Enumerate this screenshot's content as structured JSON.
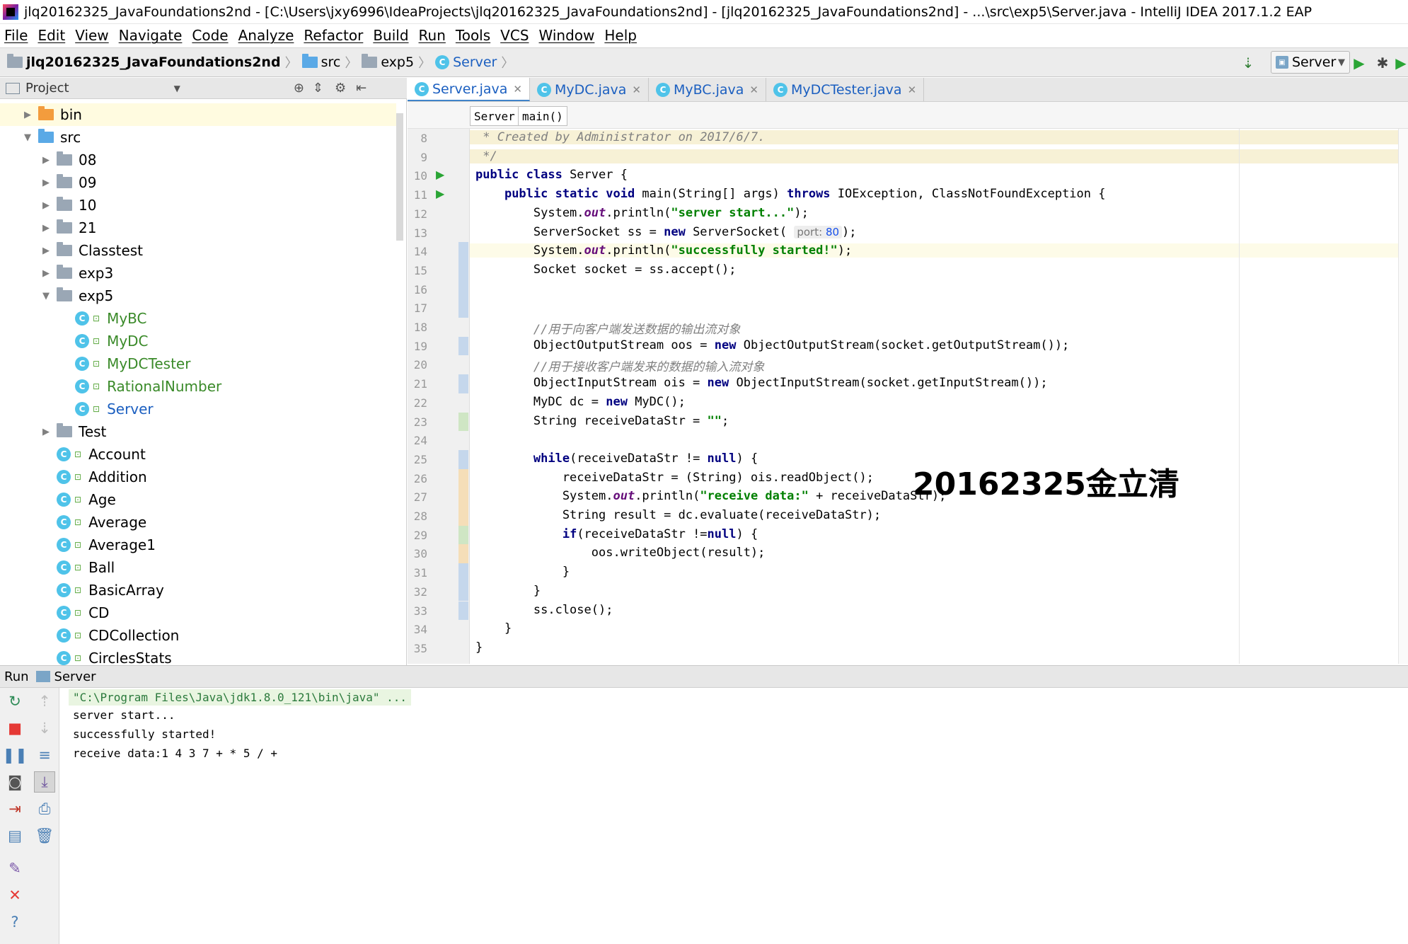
{
  "window": {
    "title": "jlq20162325_JavaFoundations2nd - [C:\\Users\\jxy6996\\IdeaProjects\\jlq20162325_JavaFoundations2nd] - [jlq20162325_JavaFoundations2nd] - ...\\src\\exp5\\Server.java - IntelliJ IDEA 2017.1.2 EAP"
  },
  "menu": [
    "File",
    "Edit",
    "View",
    "Navigate",
    "Code",
    "Analyze",
    "Refactor",
    "Build",
    "Run",
    "Tools",
    "VCS",
    "Window",
    "Help"
  ],
  "navbar": {
    "crumbs": [
      "jlq20162325_JavaFoundations2nd",
      "src",
      "exp5",
      "Server"
    ],
    "run_config": "Server"
  },
  "project": {
    "header": "Project",
    "tree": [
      {
        "label": "bin",
        "type": "folder-orange",
        "indent": 0,
        "arrow": "▶"
      },
      {
        "label": "src",
        "type": "folder-blue",
        "indent": 0,
        "arrow": "▼"
      },
      {
        "label": "08",
        "type": "package",
        "indent": 1,
        "arrow": "▶"
      },
      {
        "label": "09",
        "type": "package",
        "indent": 1,
        "arrow": "▶"
      },
      {
        "label": "10",
        "type": "package",
        "indent": 1,
        "arrow": "▶"
      },
      {
        "label": "21",
        "type": "package",
        "indent": 1,
        "arrow": "▶"
      },
      {
        "label": "Classtest",
        "type": "package",
        "indent": 1,
        "arrow": "▶"
      },
      {
        "label": "exp3",
        "type": "package",
        "indent": 1,
        "arrow": "▶"
      },
      {
        "label": "exp5",
        "type": "package",
        "indent": 1,
        "arrow": "▼"
      },
      {
        "label": "MyBC",
        "type": "class-green",
        "indent": 2,
        "arrow": ""
      },
      {
        "label": "MyDC",
        "type": "class-green",
        "indent": 2,
        "arrow": ""
      },
      {
        "label": "MyDCTester",
        "type": "class-green",
        "indent": 2,
        "arrow": ""
      },
      {
        "label": "RationalNumber",
        "type": "class-green",
        "indent": 2,
        "arrow": ""
      },
      {
        "label": "Server",
        "type": "class-blue",
        "indent": 2,
        "arrow": ""
      },
      {
        "label": "Test",
        "type": "package",
        "indent": 1,
        "arrow": "▶"
      },
      {
        "label": "Account",
        "type": "class",
        "indent": 1,
        "arrow": ""
      },
      {
        "label": "Addition",
        "type": "class",
        "indent": 1,
        "arrow": ""
      },
      {
        "label": "Age",
        "type": "class",
        "indent": 1,
        "arrow": ""
      },
      {
        "label": "Average",
        "type": "class",
        "indent": 1,
        "arrow": ""
      },
      {
        "label": "Average1",
        "type": "class",
        "indent": 1,
        "arrow": ""
      },
      {
        "label": "Ball",
        "type": "class",
        "indent": 1,
        "arrow": ""
      },
      {
        "label": "BasicArray",
        "type": "class",
        "indent": 1,
        "arrow": ""
      },
      {
        "label": "CD",
        "type": "class",
        "indent": 1,
        "arrow": ""
      },
      {
        "label": "CDCollection",
        "type": "class",
        "indent": 1,
        "arrow": ""
      },
      {
        "label": "CirclesStats",
        "type": "class",
        "indent": 1,
        "arrow": ""
      }
    ]
  },
  "editor": {
    "tabs": [
      "Server.java",
      "MyDC.java",
      "MyBC.java",
      "MyDCTester.java"
    ],
    "crumbs": [
      "Server",
      "main()"
    ],
    "lines": [
      {
        "n": "8",
        "html": "<span class='cm'> * Created by Administrator on 2017/6/7.</span>"
      },
      {
        "n": "9",
        "html": "<span class='cm'> */</span>"
      },
      {
        "n": "10",
        "html": "<span class='kw'>public class</span> Server {"
      },
      {
        "n": "11",
        "html": "    <span class='kw'>public static void</span> main(String[] args) <span class='kw'>throws</span> IOException, ClassNotFoundException {"
      },
      {
        "n": "12",
        "html": "        System.<span class='fld'>out</span>.println(<span class='str'>\"server start...\"</span>);"
      },
      {
        "n": "13",
        "html": "        ServerSocket ss = <span class='kw'>new</span> ServerSocket( <span class='hint'>port: <span class='hintnum'>80</span></span>);"
      },
      {
        "n": "14",
        "html": "        System.<span class='fld'>out</span>.println(<span class='str'>\"successfully started!\"</span>);"
      },
      {
        "n": "15",
        "html": "        Socket socket = ss.accept();"
      },
      {
        "n": "16",
        "html": ""
      },
      {
        "n": "17",
        "html": ""
      },
      {
        "n": "18",
        "html": "        <span class='cm'>//用于向客户端发送数据的输出流对象</span>"
      },
      {
        "n": "19",
        "html": "        ObjectOutputStream oos = <span class='kw'>new</span> ObjectOutputStream(socket.getOutputStream());"
      },
      {
        "n": "20",
        "html": "        <span class='cm'>//用于接收客户端发来的数据的输入流对象</span>"
      },
      {
        "n": "21",
        "html": "        ObjectInputStream ois = <span class='kw'>new</span> ObjectInputStream(socket.getInputStream());"
      },
      {
        "n": "22",
        "html": "        MyDC dc = <span class='kw'>new</span> MyDC();"
      },
      {
        "n": "23",
        "html": "        String receiveDataStr = <span class='str'>\"\"</span>;"
      },
      {
        "n": "24",
        "html": ""
      },
      {
        "n": "25",
        "html": "        <span class='kw'>while</span>(receiveDataStr != <span class='kw'>null</span>) {"
      },
      {
        "n": "26",
        "html": "            receiveDataStr = (String) ois.readObject();"
      },
      {
        "n": "27",
        "html": "            System.<span class='fld'>out</span>.println(<span class='str'>\"receive data:\"</span> + receiveDataStr);"
      },
      {
        "n": "28",
        "html": "            String result = dc.evaluate(receiveDataStr);"
      },
      {
        "n": "29",
        "html": "            <span class='kw'>if</span>(receiveDataStr !=<span class='kw'>null</span>) {"
      },
      {
        "n": "30",
        "html": "                oos.writeObject(result);"
      },
      {
        "n": "31",
        "html": "            }"
      },
      {
        "n": "32",
        "html": "        }"
      },
      {
        "n": "33",
        "html": "        ss.close();"
      },
      {
        "n": "34",
        "html": "    }"
      },
      {
        "n": "35",
        "html": "}"
      }
    ],
    "watermark": "20162325金立清"
  },
  "run": {
    "label": "Run",
    "config": "Server",
    "console": [
      "\"C:\\Program Files\\Java\\jdk1.8.0_121\\bin\\java\" ...",
      "server start...",
      "successfully started!",
      "receive data:1 4 3 7 + * 5 / +"
    ]
  }
}
